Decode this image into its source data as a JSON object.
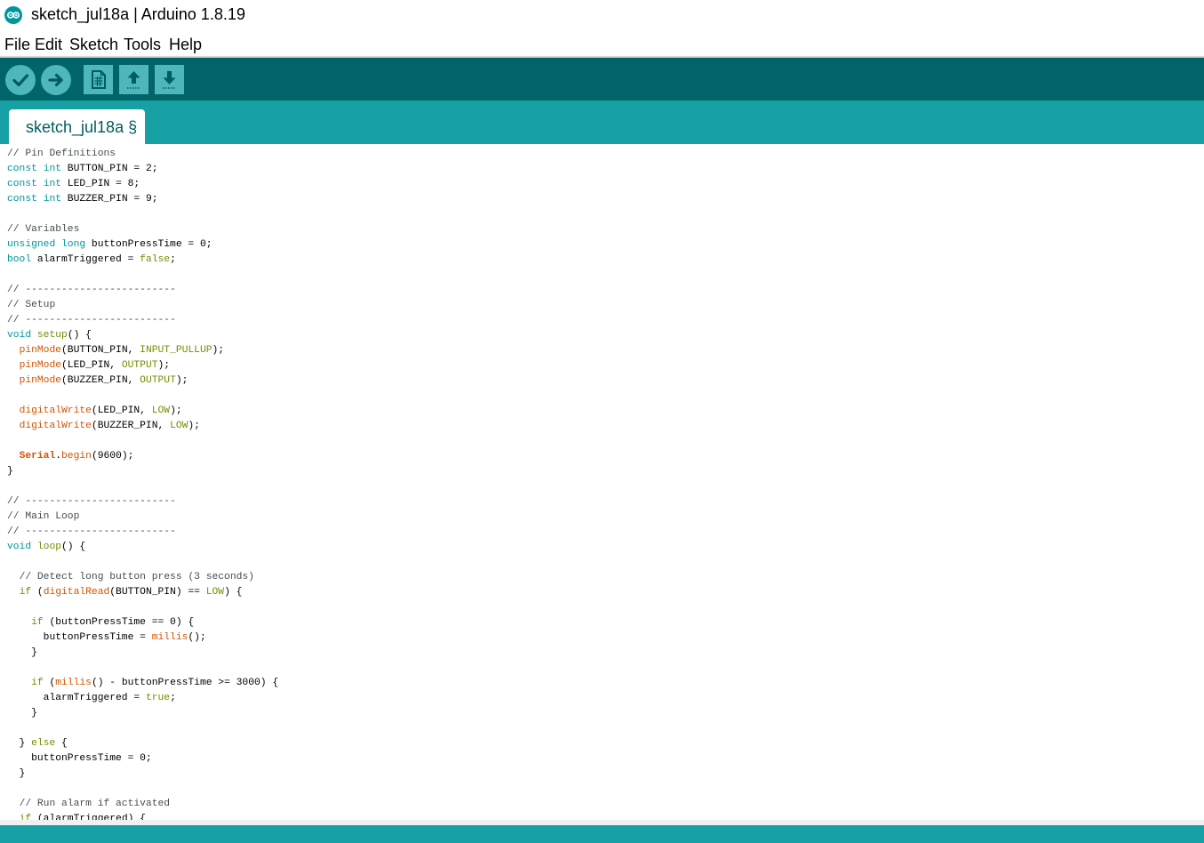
{
  "window": {
    "title": "sketch_jul18a | Arduino 1.8.19"
  },
  "menu": {
    "items": [
      "File",
      "Edit",
      "Sketch",
      "Tools",
      "Help"
    ]
  },
  "toolbar": {
    "buttons": [
      {
        "name": "verify",
        "icon": "checkmark-icon"
      },
      {
        "name": "upload",
        "icon": "arrow-right-icon"
      },
      {
        "name": "new",
        "icon": "new-file-icon"
      },
      {
        "name": "open",
        "icon": "arrow-up-icon"
      },
      {
        "name": "save",
        "icon": "arrow-down-icon"
      }
    ]
  },
  "tabs": [
    {
      "label": "sketch_jul18a §"
    }
  ],
  "colors": {
    "toolbar_bg": "#006468",
    "tabbar_bg": "#17a1a5",
    "button_bg": "#4db7bb",
    "comment": "#434f54",
    "type": "#00979c",
    "keyword": "#728e00",
    "function": "#d35400"
  },
  "code": [
    [
      [
        "c",
        "// Pin Definitions"
      ]
    ],
    [
      [
        "t",
        "const"
      ],
      [
        "x",
        " "
      ],
      [
        "t",
        "int"
      ],
      [
        "x",
        " BUTTON_PIN = 2;"
      ]
    ],
    [
      [
        "t",
        "const"
      ],
      [
        "x",
        " "
      ],
      [
        "t",
        "int"
      ],
      [
        "x",
        " LED_PIN = 8;"
      ]
    ],
    [
      [
        "t",
        "const"
      ],
      [
        "x",
        " "
      ],
      [
        "t",
        "int"
      ],
      [
        "x",
        " BUZZER_PIN = 9;"
      ]
    ],
    [],
    [
      [
        "c",
        "// Variables"
      ]
    ],
    [
      [
        "t",
        "unsigned"
      ],
      [
        "x",
        " "
      ],
      [
        "t",
        "long"
      ],
      [
        "x",
        " buttonPressTime = 0;"
      ]
    ],
    [
      [
        "t",
        "bool"
      ],
      [
        "x",
        " alarmTriggered = "
      ],
      [
        "k",
        "false"
      ],
      [
        "x",
        ";"
      ]
    ],
    [],
    [
      [
        "c",
        "// -------------------------"
      ]
    ],
    [
      [
        "c",
        "// Setup"
      ]
    ],
    [
      [
        "c",
        "// -------------------------"
      ]
    ],
    [
      [
        "t",
        "void"
      ],
      [
        "x",
        " "
      ],
      [
        "k",
        "setup"
      ],
      [
        "x",
        "() {"
      ]
    ],
    [
      [
        "x",
        "  "
      ],
      [
        "f",
        "pinMode"
      ],
      [
        "x",
        "(BUTTON_PIN, "
      ],
      [
        "k",
        "INPUT_PULLUP"
      ],
      [
        "x",
        ");"
      ]
    ],
    [
      [
        "x",
        "  "
      ],
      [
        "f",
        "pinMode"
      ],
      [
        "x",
        "(LED_PIN, "
      ],
      [
        "k",
        "OUTPUT"
      ],
      [
        "x",
        ");"
      ]
    ],
    [
      [
        "x",
        "  "
      ],
      [
        "f",
        "pinMode"
      ],
      [
        "x",
        "(BUZZER_PIN, "
      ],
      [
        "k",
        "OUTPUT"
      ],
      [
        "x",
        ");"
      ]
    ],
    [],
    [
      [
        "x",
        "  "
      ],
      [
        "f",
        "digitalWrite"
      ],
      [
        "x",
        "(LED_PIN, "
      ],
      [
        "k",
        "LOW"
      ],
      [
        "x",
        ");"
      ]
    ],
    [
      [
        "x",
        "  "
      ],
      [
        "f",
        "digitalWrite"
      ],
      [
        "x",
        "(BUZZER_PIN, "
      ],
      [
        "k",
        "LOW"
      ],
      [
        "x",
        ");"
      ]
    ],
    [],
    [
      [
        "x",
        "  "
      ],
      [
        "s",
        "Serial"
      ],
      [
        "x",
        "."
      ],
      [
        "f",
        "begin"
      ],
      [
        "x",
        "(9600);"
      ]
    ],
    [
      [
        "x",
        "}"
      ]
    ],
    [],
    [
      [
        "c",
        "// -------------------------"
      ]
    ],
    [
      [
        "c",
        "// Main Loop"
      ]
    ],
    [
      [
        "c",
        "// -------------------------"
      ]
    ],
    [
      [
        "t",
        "void"
      ],
      [
        "x",
        " "
      ],
      [
        "k",
        "loop"
      ],
      [
        "x",
        "() {"
      ]
    ],
    [],
    [
      [
        "x",
        "  "
      ],
      [
        "c",
        "// Detect long button press (3 seconds)"
      ]
    ],
    [
      [
        "x",
        "  "
      ],
      [
        "k",
        "if"
      ],
      [
        "x",
        " ("
      ],
      [
        "f",
        "digitalRead"
      ],
      [
        "x",
        "(BUTTON_PIN) == "
      ],
      [
        "k",
        "LOW"
      ],
      [
        "x",
        ") {"
      ]
    ],
    [],
    [
      [
        "x",
        "    "
      ],
      [
        "k",
        "if"
      ],
      [
        "x",
        " (buttonPressTime == 0) {"
      ]
    ],
    [
      [
        "x",
        "      buttonPressTime = "
      ],
      [
        "f",
        "millis"
      ],
      [
        "x",
        "();"
      ]
    ],
    [
      [
        "x",
        "    }"
      ]
    ],
    [],
    [
      [
        "x",
        "    "
      ],
      [
        "k",
        "if"
      ],
      [
        "x",
        " ("
      ],
      [
        "f",
        "millis"
      ],
      [
        "x",
        "() - buttonPressTime >= 3000) {"
      ]
    ],
    [
      [
        "x",
        "      alarmTriggered = "
      ],
      [
        "k",
        "true"
      ],
      [
        "x",
        ";"
      ]
    ],
    [
      [
        "x",
        "    }"
      ]
    ],
    [],
    [
      [
        "x",
        "  } "
      ],
      [
        "k",
        "else"
      ],
      [
        "x",
        " {"
      ]
    ],
    [
      [
        "x",
        "    buttonPressTime = 0;"
      ]
    ],
    [
      [
        "x",
        "  }"
      ]
    ],
    [],
    [
      [
        "x",
        "  "
      ],
      [
        "c",
        "// Run alarm if activated"
      ]
    ],
    [
      [
        "x",
        "  "
      ],
      [
        "k",
        "if"
      ],
      [
        "x",
        " (alarmTriggered) {"
      ]
    ]
  ]
}
